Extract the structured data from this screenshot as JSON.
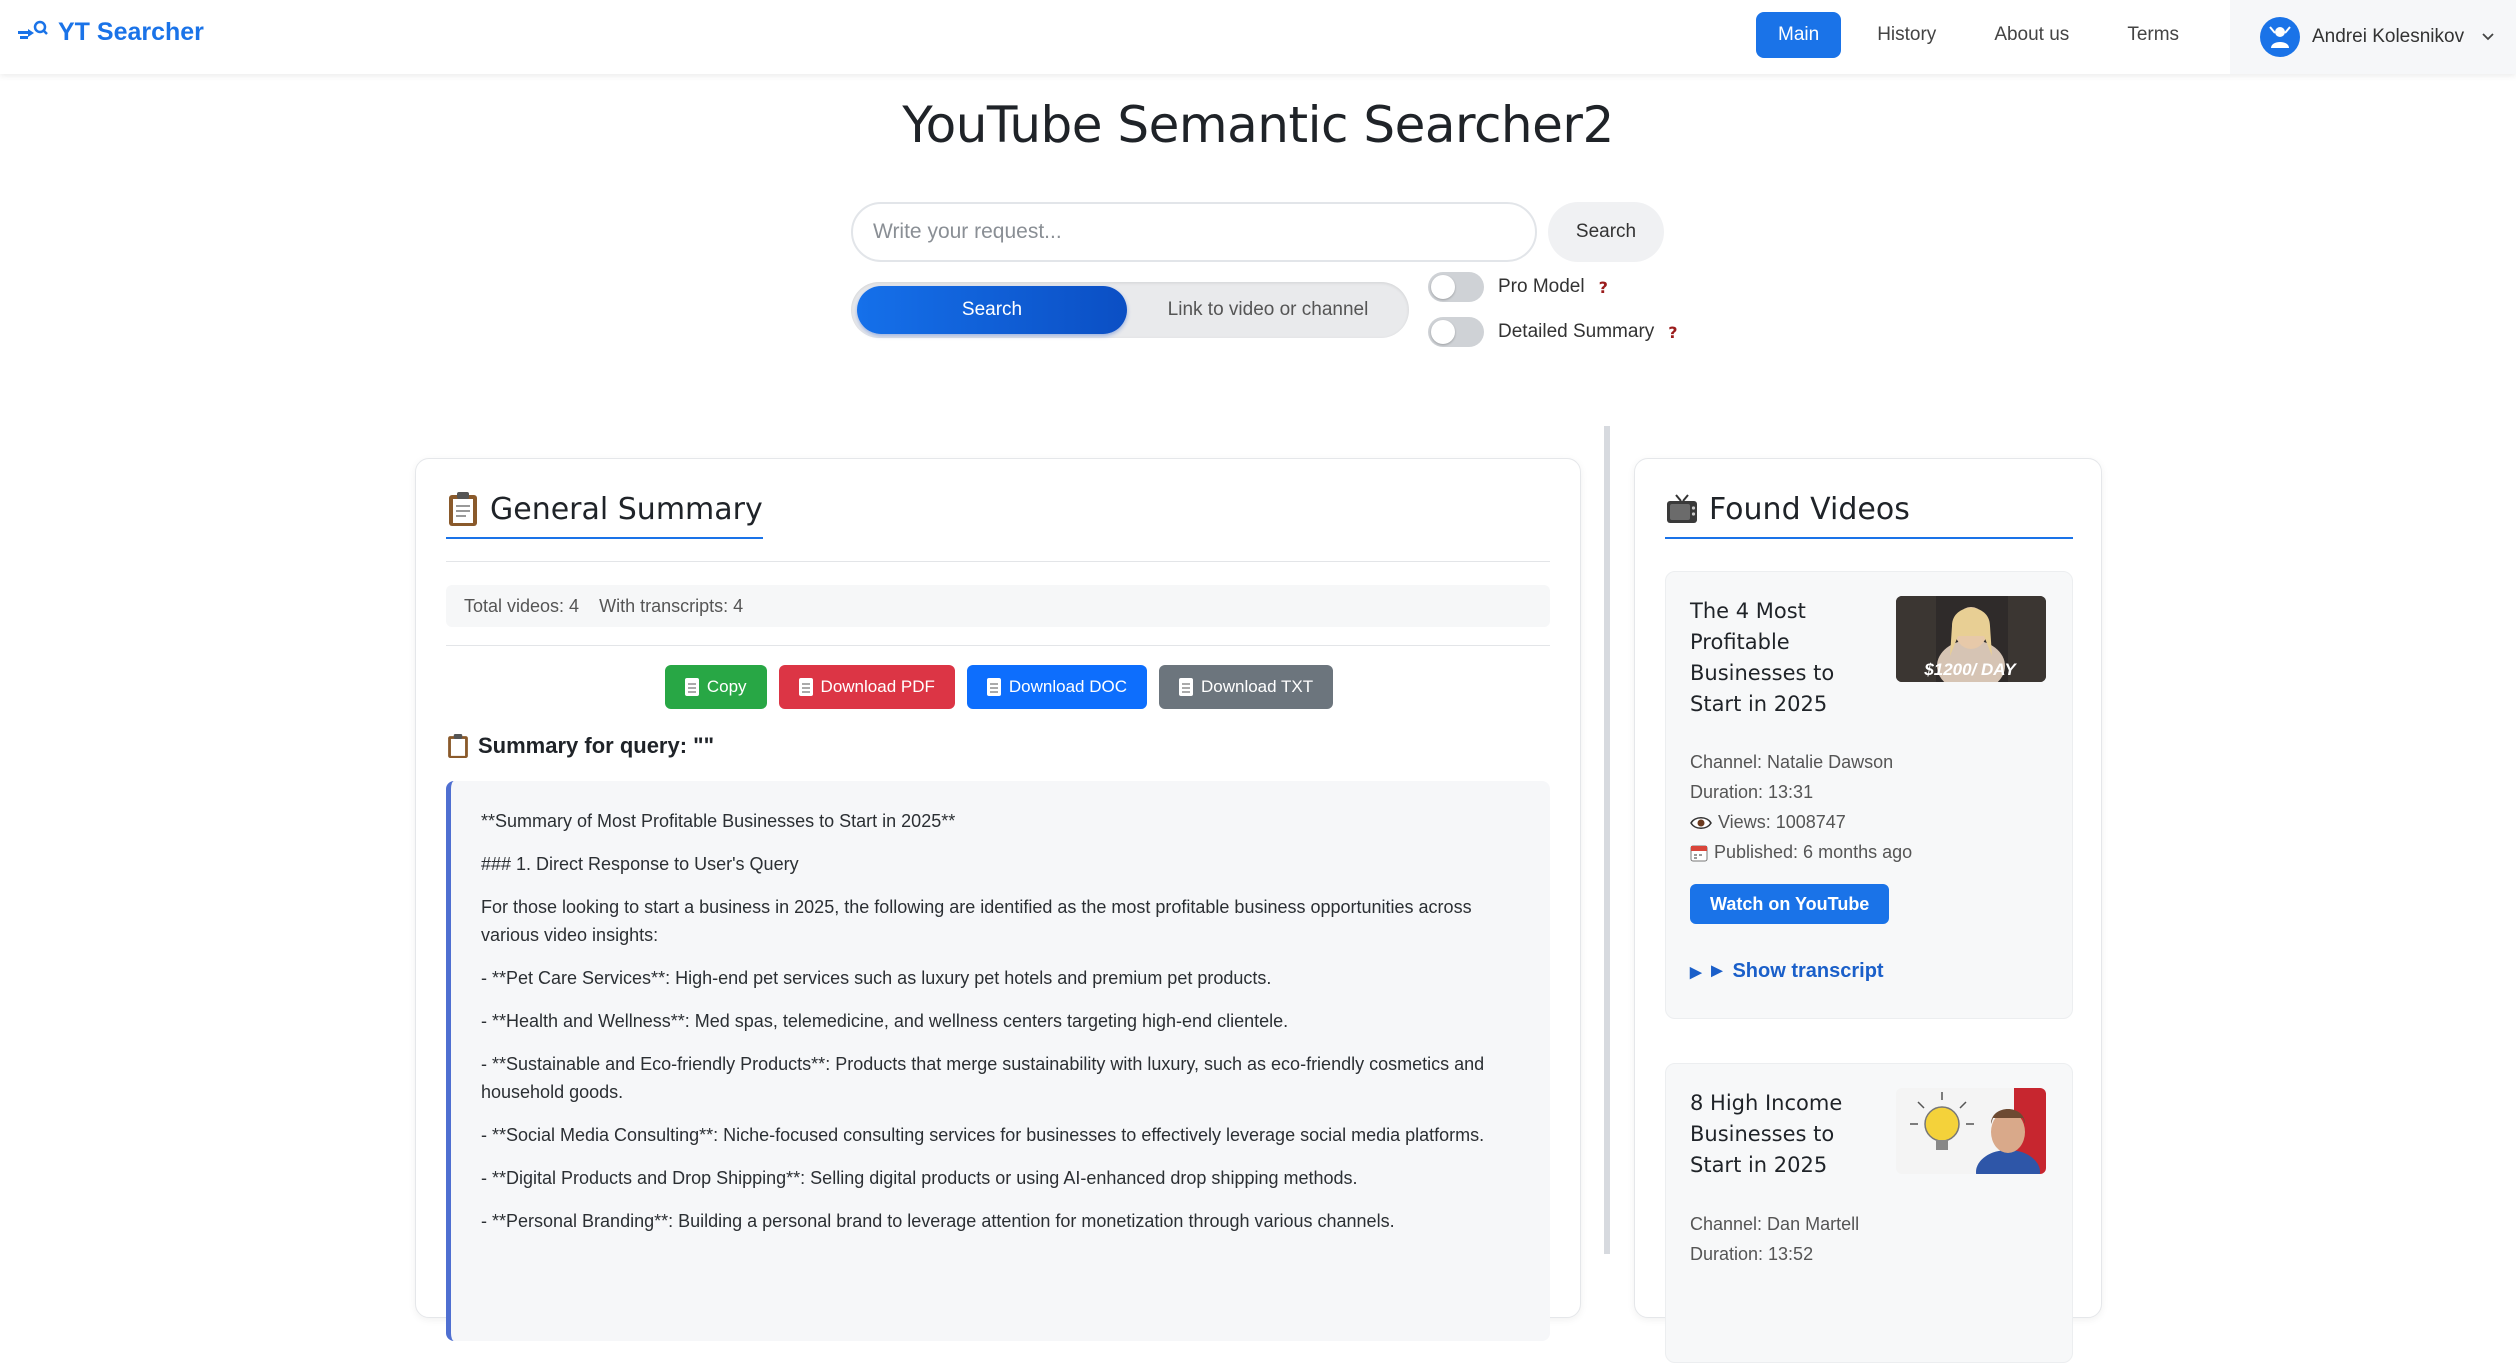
{
  "nav": {
    "brand": "YT Searcher",
    "links": [
      "Main",
      "History",
      "About us",
      "Terms"
    ],
    "user_name": "Andrei Kolesnikov"
  },
  "header": {
    "title": "YouTube Semantic Searcher2",
    "search_placeholder": "Write your request...",
    "search_button": "Search",
    "mode_search": "Search",
    "mode_link": "Link to video or channel",
    "pro_model_label": "Pro Model",
    "detailed_summary_label": "Detailed Summary"
  },
  "summary": {
    "title": "General Summary",
    "total_videos": "Total videos: 4",
    "with_transcripts": "With transcripts: 4",
    "buttons": {
      "copy": "Copy",
      "pdf": "Download PDF",
      "doc": "Download DOC",
      "txt": "Download TXT"
    },
    "query_heading": "Summary for query: \"\"",
    "paragraphs": [
      "**Summary of Most Profitable Businesses to Start in 2025**",
      "### 1. Direct Response to User's Query",
      "For those looking to start a business in 2025, the following are identified as the most profitable business opportunities across various video insights:",
      "- **Pet Care Services**: High-end pet services such as luxury pet hotels and premium pet products.",
      "- **Health and Wellness**: Med spas, telemedicine, and wellness centers targeting high-end clientele.",
      "- **Sustainable and Eco-friendly Products**: Products that merge sustainability with luxury, such as eco-friendly cosmetics and household goods.",
      "- **Social Media Consulting**: Niche-focused consulting services for businesses to effectively leverage social media platforms.",
      "- **Digital Products and Drop Shipping**: Selling digital products or using AI-enhanced drop shipping methods.",
      "- **Personal Branding**: Building a personal brand to leverage attention for monetization through various channels."
    ]
  },
  "videos": {
    "title": "Found Videos",
    "items": [
      {
        "title": "The 4 Most Profitable Businesses to Start in 2025",
        "thumb_text": "$1200/ DAY",
        "channel": "Channel: Natalie Dawson",
        "duration": "Duration: 13:31",
        "views": "Views: 1008747",
        "published": "Published: 6 months ago",
        "watch": "Watch on YouTube",
        "transcript": "► Show transcript"
      },
      {
        "title": "8 High Income Businesses to Start in 2025",
        "channel": "Channel: Dan Martell",
        "duration": "Duration: 13:52"
      }
    ]
  }
}
